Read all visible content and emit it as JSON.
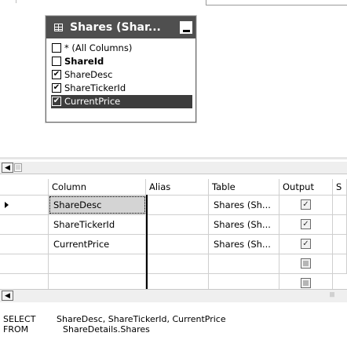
{
  "diagram": {
    "table_box": {
      "title": "Shares (Shar...",
      "columns": [
        {
          "label": "* (All Columns)",
          "checked": false,
          "bold": false,
          "selected": false
        },
        {
          "label": "ShareId",
          "checked": false,
          "bold": true,
          "selected": false
        },
        {
          "label": "ShareDesc",
          "checked": true,
          "bold": false,
          "selected": false
        },
        {
          "label": "ShareTickerId",
          "checked": true,
          "bold": false,
          "selected": false
        },
        {
          "label": "CurrentPrice",
          "checked": true,
          "bold": false,
          "selected": true
        }
      ]
    }
  },
  "grid": {
    "headers": {
      "column": "Column",
      "alias": "Alias",
      "table": "Table",
      "output": "Output",
      "extra": "S"
    },
    "rows": [
      {
        "column": "ShareDesc",
        "alias": "",
        "table": "Shares (Sh...",
        "output": true,
        "current": true
      },
      {
        "column": "ShareTickerId",
        "alias": "",
        "table": "Shares (Sh...",
        "output": true,
        "current": false
      },
      {
        "column": "CurrentPrice",
        "alias": "",
        "table": "Shares (Sh...",
        "output": true,
        "current": false
      },
      {
        "column": "",
        "alias": "",
        "table": "",
        "output": null,
        "current": false
      }
    ]
  },
  "sql": {
    "select_kw": "SELECT",
    "select_text": "ShareDesc, ShareTickerId, CurrentPrice",
    "from_kw": "FROM",
    "from_text": "ShareDetails.Shares"
  },
  "glyphs": {
    "check": "✔",
    "check_small": "✓",
    "left_arrow": "◀",
    "grip": "|||"
  }
}
